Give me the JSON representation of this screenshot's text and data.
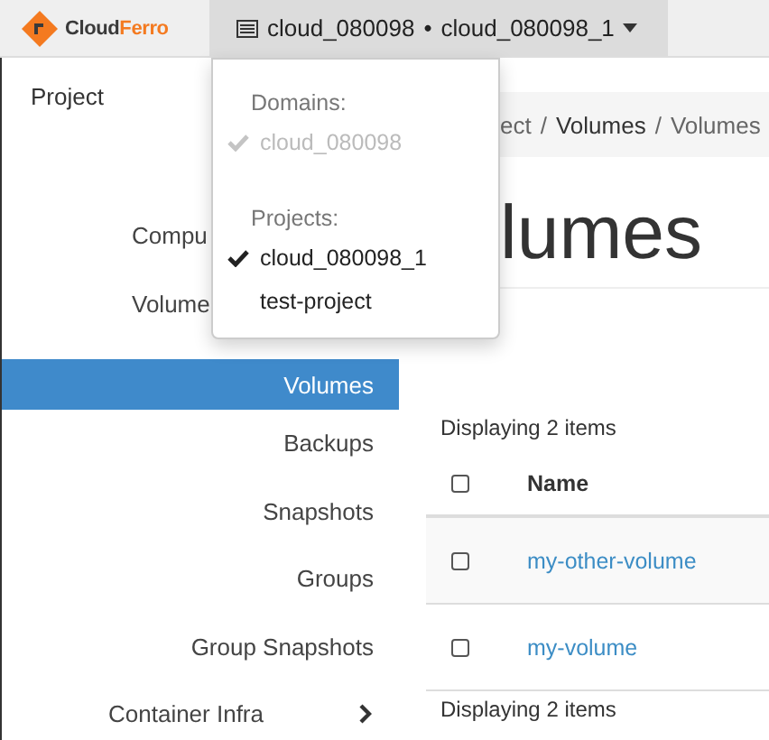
{
  "header": {
    "logo": {
      "text": "CloudFerro"
    },
    "context": {
      "domain": "cloud_080098",
      "separator": "•",
      "project": "cloud_080098_1"
    }
  },
  "context_menu": {
    "sections": [
      {
        "label": "Domains:",
        "items": [
          {
            "label": "cloud_080098",
            "selected": true,
            "disabled": true
          }
        ]
      },
      {
        "label": "Projects:",
        "items": [
          {
            "label": "cloud_080098_1",
            "selected": true,
            "disabled": false
          },
          {
            "label": "test-project",
            "selected": false,
            "disabled": false
          }
        ]
      }
    ]
  },
  "sidebar": {
    "title": "Project",
    "items": [
      {
        "label": "Compu",
        "selected": false,
        "kind": "group"
      },
      {
        "label": "Volume",
        "selected": false,
        "kind": "group"
      },
      {
        "label": "Volumes",
        "selected": true,
        "kind": "item"
      },
      {
        "label": "Backups",
        "selected": false,
        "kind": "item"
      },
      {
        "label": "Snapshots",
        "selected": false,
        "kind": "item"
      },
      {
        "label": "Groups",
        "selected": false,
        "kind": "item"
      },
      {
        "label": "Group Snapshots",
        "selected": false,
        "kind": "item"
      },
      {
        "label": "Container Infra",
        "selected": false,
        "kind": "collapsed"
      }
    ]
  },
  "breadcrumb": {
    "separator": "/",
    "items": [
      "ect",
      "Volumes",
      "Volumes"
    ]
  },
  "page_title": "lumes",
  "table": {
    "summary_top": "Displaying 2 items",
    "header": {
      "checked": false,
      "columns": [
        "Name"
      ]
    },
    "rows": [
      {
        "checked": false,
        "name": "my-other-volume"
      },
      {
        "checked": false,
        "name": "my-volume"
      }
    ],
    "summary_bottom": "Displaying 2 items"
  }
}
